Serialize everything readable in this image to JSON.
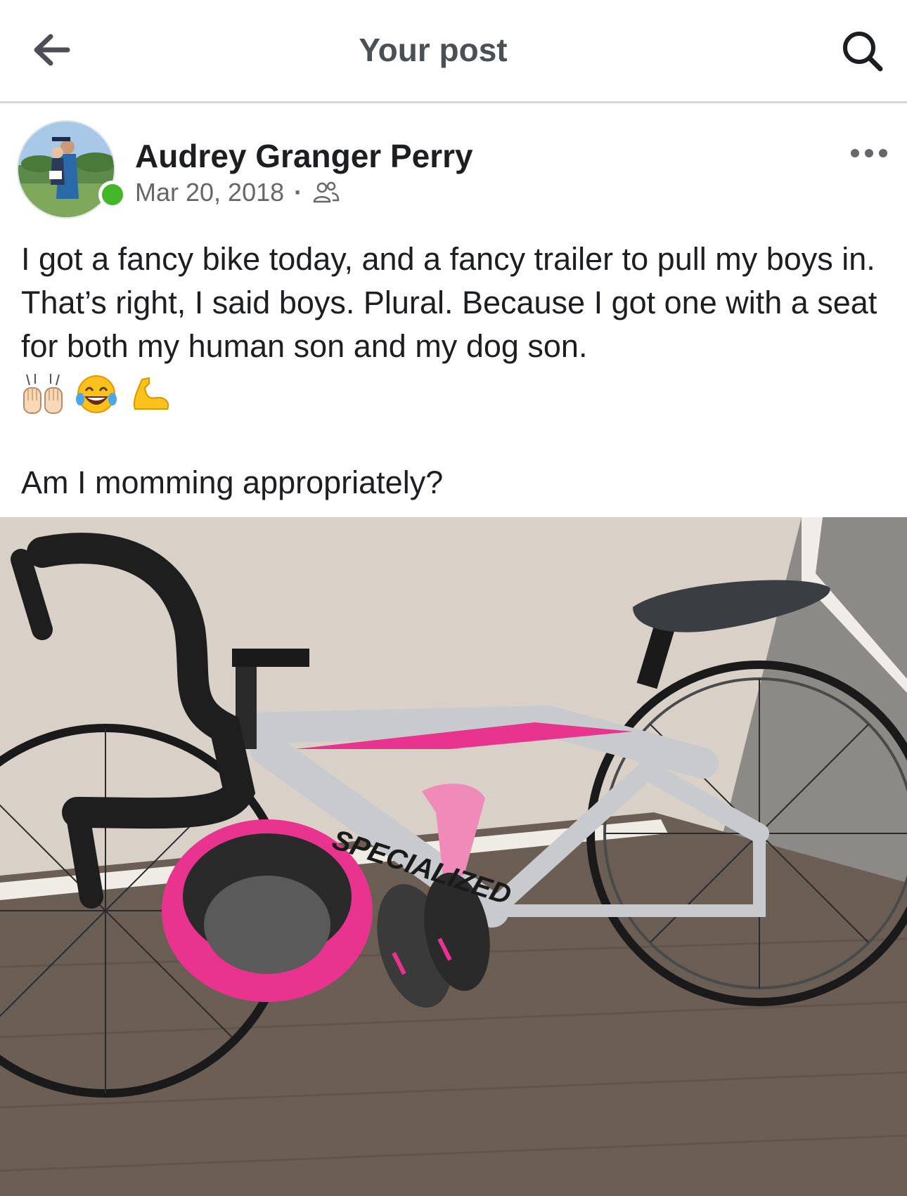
{
  "header": {
    "title": "Your post",
    "back_icon": "arrow-left-icon",
    "search_icon": "search-icon"
  },
  "post": {
    "author": "Audrey Granger Perry",
    "date": "Mar 20, 2018",
    "separator": "·",
    "privacy_icon": "friends-icon",
    "more_icon": "more-dots-icon",
    "text": "I got a fancy bike today, and a fancy trailer to pull my boys in. That’s right, I said boys. Plural. Because I got one with a seat for both my human son and my dog son.",
    "emojis": [
      "raising-hands-icon",
      "tears-of-joy-icon",
      "flexed-biceps-icon"
    ],
    "text_2": "Am I momming appropriately?",
    "photo_brand": "SPECIALIZED"
  },
  "colors": {
    "title_gray": "#4b4f56",
    "meta_gray": "#65676b",
    "online_green": "#42b72a",
    "bike_pink": "#e8348f",
    "frame_silver": "#c9cacd",
    "floor_brown": "#6b5e55",
    "wall_beige": "#d9d1c7"
  }
}
